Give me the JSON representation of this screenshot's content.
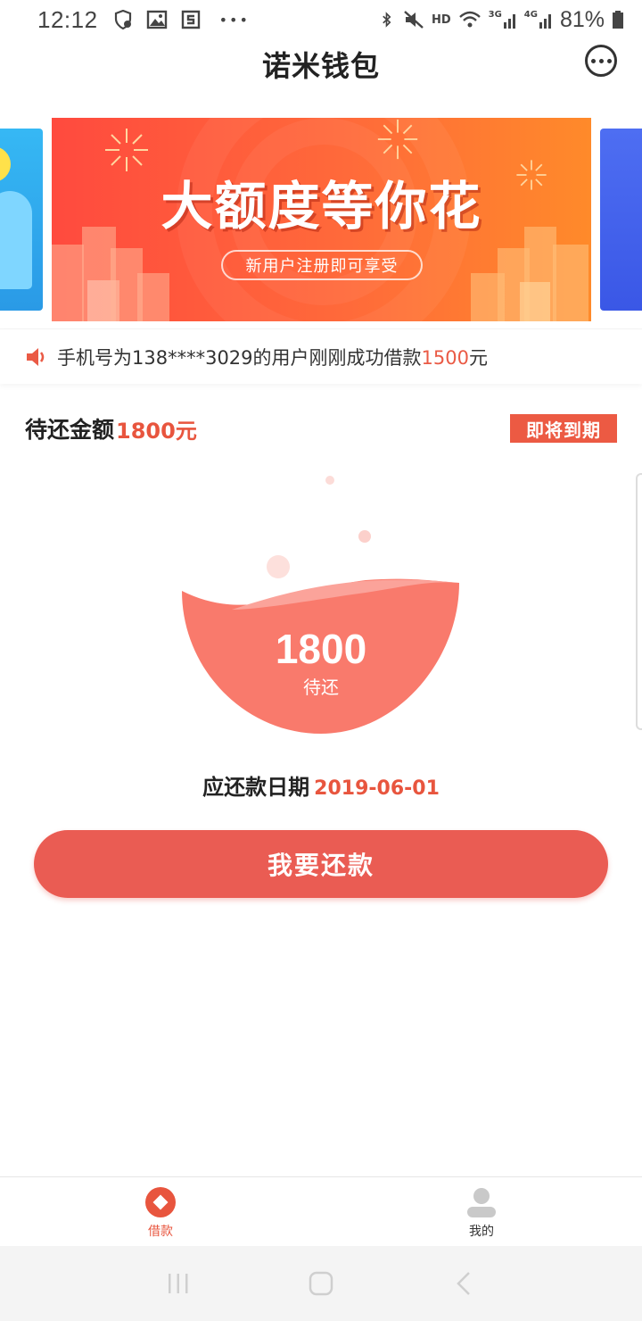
{
  "status_bar": {
    "time": "12:12",
    "battery": "81%",
    "icons": [
      "notification-shield-icon",
      "gallery-icon",
      "app-s-icon",
      "more-dots-icon",
      "bluetooth-icon",
      "mute-icon",
      "hd-icon",
      "wifi-icon",
      "signal-3g-icon",
      "signal-4g-icon",
      "battery-icon"
    ],
    "network_labels": {
      "hd": "HD",
      "g3": "3G",
      "g4": "4G"
    },
    "overflow": "•••"
  },
  "header": {
    "title": "诺米钱包"
  },
  "banner": {
    "title": "大额度等你花",
    "subtitle": "新用户注册即可享受"
  },
  "notice": {
    "prefix": "手机号为138****3029的用户刚刚成功借款",
    "amount": "1500",
    "suffix": "元"
  },
  "summary": {
    "label": "待还金额",
    "amount": "1800元",
    "badge": "即将到期"
  },
  "bowl": {
    "value": "1800",
    "caption": "待还"
  },
  "due": {
    "label": "应还款日期",
    "date": "2019-06-01"
  },
  "actions": {
    "repay_label": "我要还款"
  },
  "tabs": [
    {
      "label": "借款",
      "icon": "borrow-icon",
      "active": true
    },
    {
      "label": "我的",
      "icon": "user-icon",
      "active": false
    }
  ],
  "colors": {
    "accent": "#e8553e",
    "button": "#ea5c53",
    "bowl": "#f97a6c"
  }
}
